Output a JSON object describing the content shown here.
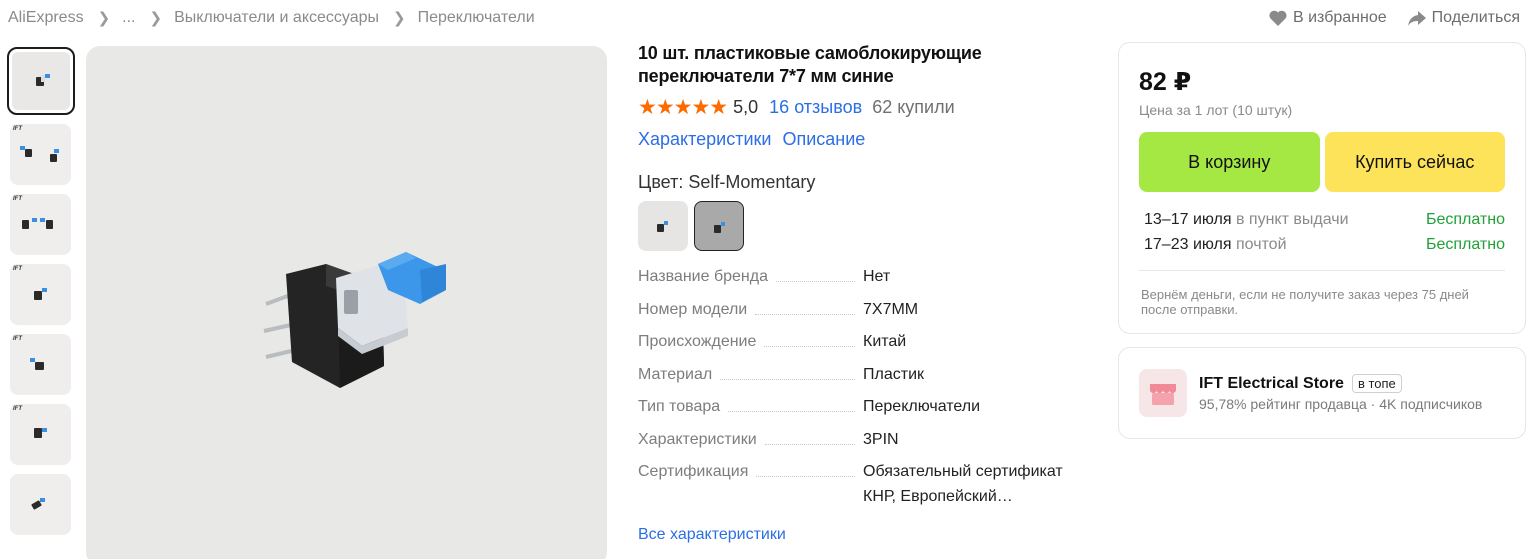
{
  "breadcrumb": [
    "AliExpress",
    "...",
    "Выключатели и аксессуары",
    "Переключатели"
  ],
  "top_actions": {
    "favorite": "В избранное",
    "share": "Поделиться"
  },
  "product": {
    "title": "10 шт. пластиковые самоблокирующие переключатели 7*7 мм синие",
    "rating": "5,0",
    "reviews": "16 отзывов",
    "bought": "62 купили",
    "tabs": [
      "Характеристики",
      "Описание"
    ],
    "color_label": "Цвет: Self-Momentary",
    "specs": [
      {
        "key": "Название бренда",
        "value": "Нет"
      },
      {
        "key": "Номер модели",
        "value": "7X7MM"
      },
      {
        "key": "Происхождение",
        "value": "Китай"
      },
      {
        "key": "Материал",
        "value": "Пластик"
      },
      {
        "key": "Тип товара",
        "value": "Переключатели"
      },
      {
        "key": "Характеристики",
        "value": "3PIN"
      },
      {
        "key": "Сертификация",
        "value": "Обязательный сертификат КНР, Европейский…"
      }
    ],
    "all_specs_link": "Все характеристики"
  },
  "buy_box": {
    "price": "82 ₽",
    "price_note": "Цена за 1 лот (10 штук)",
    "cart_button": "В корзину",
    "buy_button": "Купить сейчас",
    "delivery": [
      {
        "dates": "13–17 июля",
        "method": "в пункт выдачи",
        "cost": "Бесплатно"
      },
      {
        "dates": "17–23 июля",
        "method": "почтой",
        "cost": "Бесплатно"
      }
    ],
    "refund_note": "Вернём деньги, если не получите заказ через 75 дней после отправки."
  },
  "store": {
    "name": "IFT Electrical Store",
    "badge": "в топе",
    "rating": "95,78% рейтинг продавца",
    "subscribers": "4K подписчиков"
  },
  "colors": {
    "accent_blue": "#2b6ee6",
    "star": "#ff6a00",
    "cart_green": "#a6e843",
    "buy_yellow": "#fde35a",
    "free_green": "#21a038"
  }
}
